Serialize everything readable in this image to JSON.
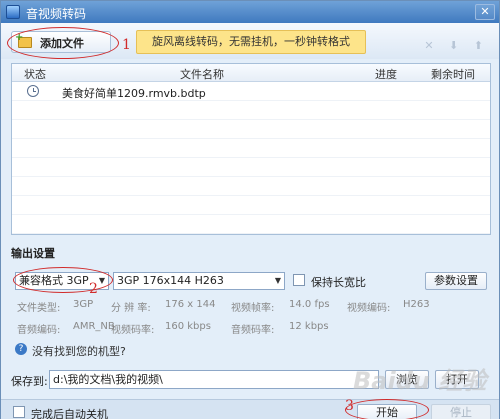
{
  "window": {
    "title": "音视频转码",
    "close_glyph": "✕"
  },
  "toolbar": {
    "add_file_label": "添加文件",
    "promo_text": "旋风离线转码，无需挂机，一秒钟转格式",
    "tool_icons": "✕ ⬇ ⬆"
  },
  "file_table": {
    "columns": [
      "状态",
      "文件名称",
      "进度",
      "剩余时间"
    ],
    "rows": [
      {
        "status_icon": "clock-icon",
        "name": "美食好简单1209.rmvb.bdtp",
        "progress": "",
        "remaining": ""
      }
    ]
  },
  "output": {
    "section_label": "输出设置",
    "format_value": "兼容格式 3GP",
    "preset_value": "3GP 176x144 H263",
    "keep_ratio_label": "保持长宽比",
    "param_button": "参数设置",
    "info": {
      "file_type_label": "文件类型:",
      "file_type_value": "3GP",
      "resolution_label": "分 辨 率:",
      "resolution_value": "176 x 144",
      "video_fps_label": "视频帧率:",
      "video_fps_value": "14.0 fps",
      "video_codec_label": "视频编码:",
      "video_codec_value": "H263",
      "audio_codec_label": "音频编码:",
      "audio_codec_value": "AMR_NB",
      "video_bitrate_label": "视频码率:",
      "video_bitrate_value": "160 kbps",
      "audio_bitrate_label": "音频码率:",
      "audio_bitrate_value": "12 kbps"
    },
    "help_link": "没有找到您的机型?"
  },
  "save": {
    "label": "保存到:",
    "path": "d:\\我的文档\\我的视频\\",
    "browse_button": "浏览",
    "open_button": "打开"
  },
  "footer": {
    "shutdown_label": "完成后自动关机",
    "start_button": "开始",
    "stop_button": "停止"
  },
  "annotations": {
    "one": "1",
    "two": "2",
    "three": "3"
  },
  "watermark": "Baidu 经验"
}
